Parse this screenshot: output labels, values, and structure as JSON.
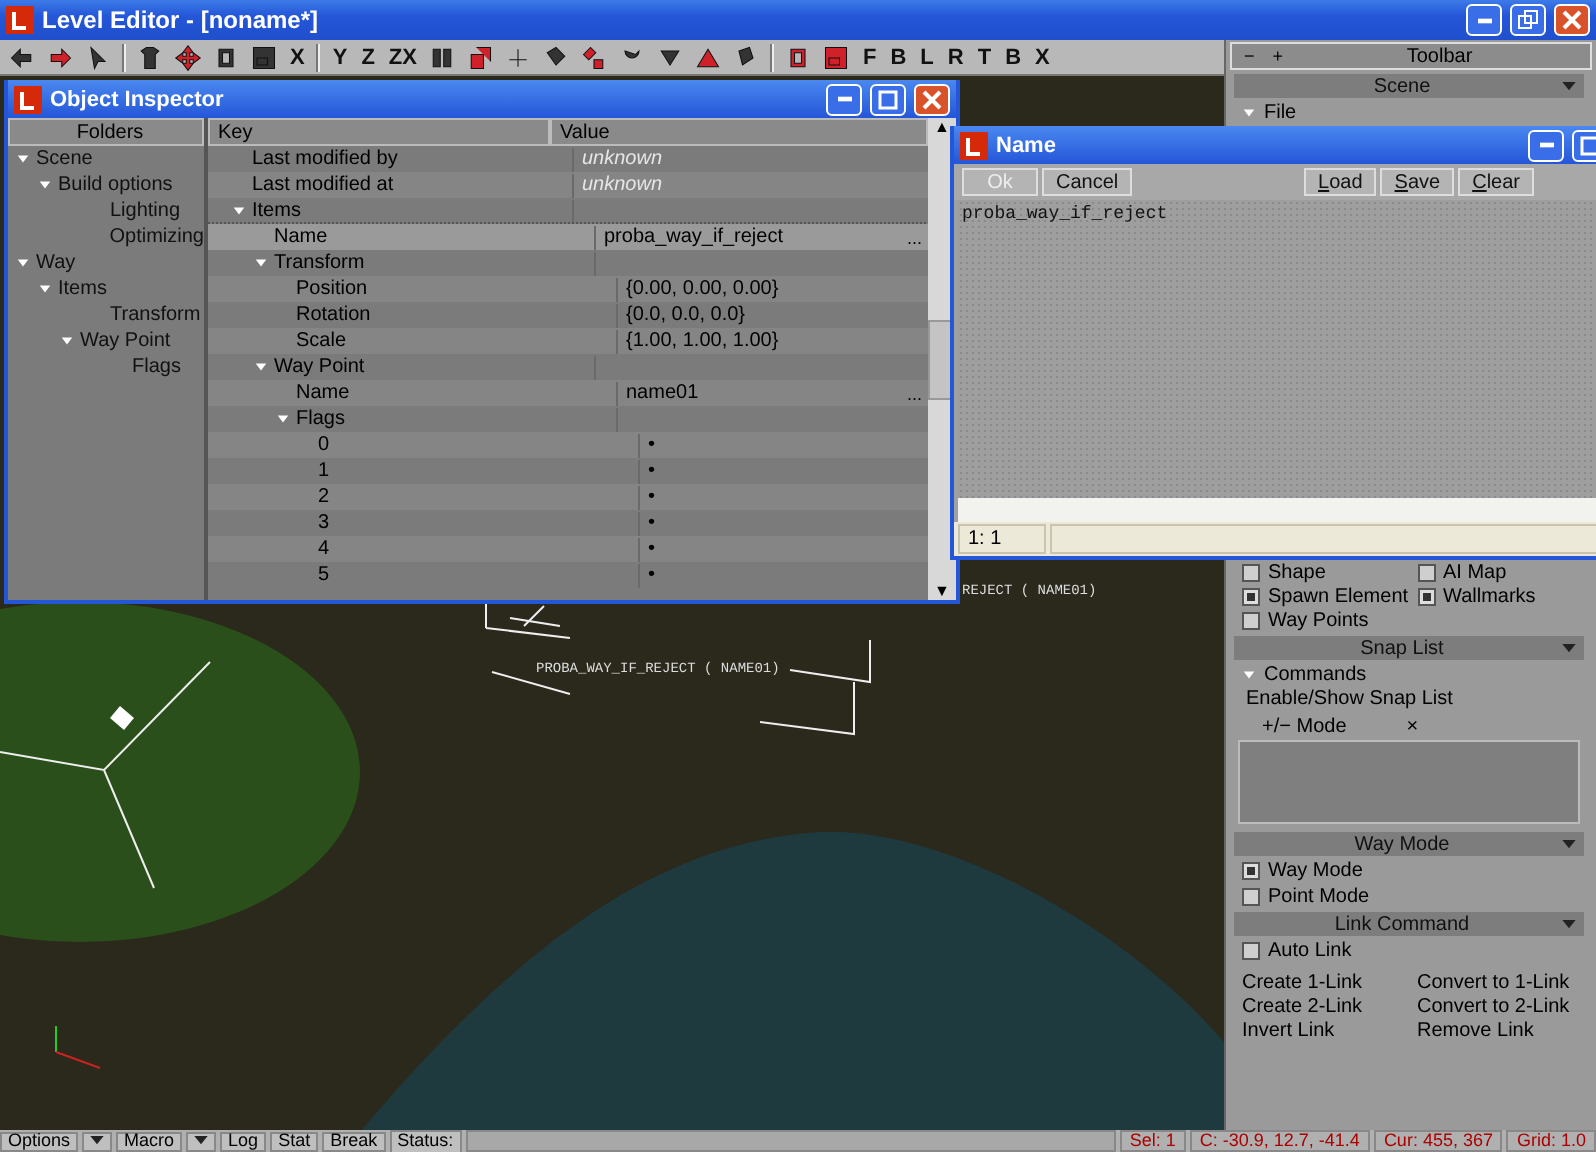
{
  "window": {
    "title": "Level Editor - [noname*]"
  },
  "toolbar": {
    "lock_buttons": [
      "X",
      "Y",
      "Z",
      "ZX"
    ],
    "view_buttons": [
      "F",
      "B",
      "L",
      "R",
      "T",
      "B",
      "X"
    ]
  },
  "viewport": {
    "labels": [
      "PROBA_WAY_IF_REJECT ( NAME01)",
      "REJECT ( NAME01)"
    ]
  },
  "object_inspector": {
    "title": "Object Inspector",
    "folders_header": "Folders",
    "folders": [
      {
        "label": "Scene",
        "expanded": true,
        "children": [
          {
            "label": "Build options",
            "expanded": true,
            "children": [
              {
                "label": "Lighting"
              },
              {
                "label": "Optimizing"
              }
            ]
          }
        ]
      },
      {
        "label": "Way",
        "expanded": true,
        "children": [
          {
            "label": "Items",
            "expanded": true,
            "children": [
              {
                "label": "Transform"
              },
              {
                "label": "Way Point",
                "expanded": true,
                "children": [
                  {
                    "label": "Flags"
                  }
                ]
              }
            ]
          }
        ]
      }
    ],
    "columns": [
      "Key",
      "Value"
    ],
    "scroll_arrows": [
      "▲",
      "▼"
    ],
    "rows": [
      {
        "key": "Last modified by",
        "value": "unknown",
        "disabled": true,
        "selected": false
      },
      {
        "key": "Last modified at",
        "value": "unknown",
        "disabled": true,
        "selected": false
      },
      {
        "key": "Items",
        "expanded": true,
        "selected": false,
        "children": [
          {
            "key": "Name",
            "value": "proba_way_if_reject",
            "button": "...",
            "selected": true,
            "disabled": false
          },
          {
            "key": "Transform",
            "expanded": true,
            "selected": false,
            "children": [
              {
                "key": "Position",
                "value": "{0.00, 0.00, 0.00}",
                "selected": false,
                "disabled": false
              },
              {
                "key": "Rotation",
                "value": "{0.0, 0.0, 0.0}",
                "selected": false,
                "disabled": false
              },
              {
                "key": "Scale",
                "value": "{1.00, 1.00, 1.00}",
                "selected": false,
                "disabled": false
              }
            ]
          },
          {
            "key": "Way Point",
            "expanded": true,
            "selected": false,
            "children": [
              {
                "key": "Name",
                "value": "name01",
                "button": "...",
                "selected": false,
                "disabled": false
              },
              {
                "key": "Flags",
                "expanded": true,
                "selected": false,
                "children": [
                  {
                    "key": "0",
                    "value": "•",
                    "selected": false,
                    "disabled": false
                  },
                  {
                    "key": "1",
                    "value": "•",
                    "selected": false,
                    "disabled": false
                  },
                  {
                    "key": "2",
                    "value": "•",
                    "selected": false,
                    "disabled": false
                  },
                  {
                    "key": "3",
                    "value": "•",
                    "selected": false,
                    "disabled": false
                  },
                  {
                    "key": "4",
                    "value": "•",
                    "selected": false,
                    "disabled": false
                  },
                  {
                    "key": "5",
                    "value": "•",
                    "selected": false,
                    "disabled": false
                  }
                ]
              }
            ]
          }
        ]
      }
    ]
  },
  "name_dialog": {
    "title": "Name",
    "buttons": [
      {
        "label": "Ok",
        "disabled": true
      },
      {
        "label": "Cancel",
        "disabled": false
      }
    ],
    "file_buttons": [
      "Load",
      "Save",
      "Clear"
    ],
    "text": "proba_way_if_reject",
    "cursor": "1: 1"
  },
  "side_panel": {
    "title": "Toolbar",
    "title_buttons": [
      "−",
      "+"
    ],
    "scene": {
      "title": "Scene",
      "group": "File"
    },
    "objects": [
      {
        "label": "Shape",
        "checked": false
      },
      {
        "label": "AI Map",
        "checked": false
      },
      {
        "label": "Spawn Element",
        "checked": true
      },
      {
        "label": "Wallmarks",
        "checked": true
      },
      {
        "label": "Way Points",
        "checked": false
      }
    ],
    "snap_list": {
      "title": "Snap List",
      "group": "Commands",
      "command": "Enable/Show Snap List",
      "columns": [
        "+/− Mode",
        "×"
      ]
    },
    "way_mode": {
      "title": "Way Mode",
      "options": [
        {
          "label": "Way Mode",
          "checked": true
        },
        {
          "label": "Point Mode",
          "checked": false
        }
      ]
    },
    "link_command": {
      "title": "Link Command",
      "options": [
        {
          "label": "Auto Link",
          "checked": false
        }
      ],
      "commands": [
        "Create 1-Link",
        "Convert to 1-Link",
        "Create 2-Link",
        "Convert to 2-Link",
        "Invert Link",
        "Remove Link"
      ]
    }
  },
  "status_bar": {
    "menus": [
      "Options",
      "Macro"
    ],
    "buttons": [
      "Log",
      "Stat",
      "Break"
    ],
    "status_label": "Status:",
    "selection": "Sel: 1",
    "coords": "C: -30.9, 12.7, -41.4",
    "cursor": "Cur: 455, 367",
    "grid": "Grid: 1.0"
  }
}
